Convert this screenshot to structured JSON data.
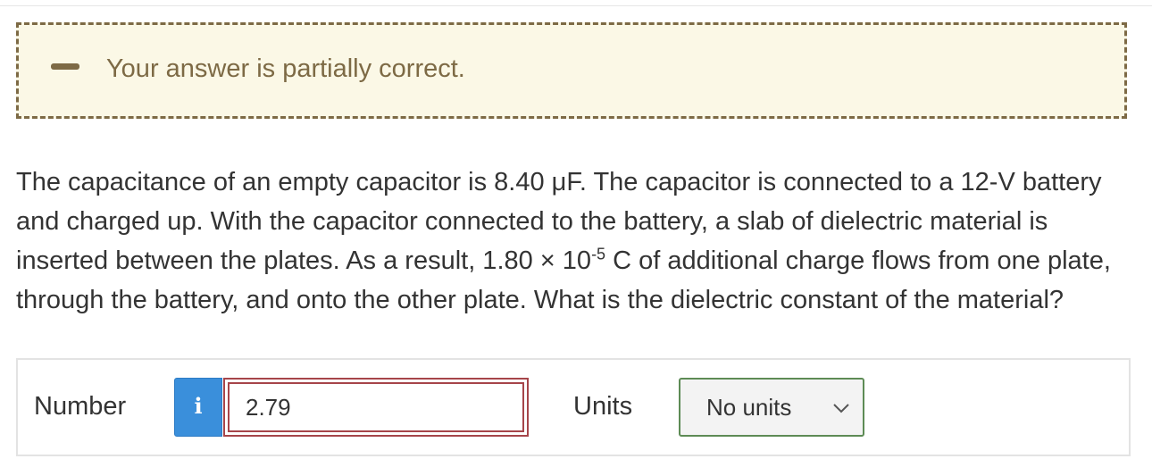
{
  "feedback": {
    "message": "Your answer is partially correct.",
    "icon": "minus-icon",
    "color": "#7d6a45",
    "background": "#fbf8e6"
  },
  "question": {
    "part1": "The capacitance of an empty capacitor is 8.40 μF. The capacitor is connected to a 12-V battery and charged up. With the capacitor connected to the battery, a slab of dielectric material is inserted between the plates. As a result, 1.80 × 10",
    "exponent": "-5",
    "part2": " C of additional charge flows from one plate, through the battery, and onto the other plate. What is the dielectric constant of the material?"
  },
  "answer": {
    "number_label": "Number",
    "info_label": "i",
    "number_value": "2.79",
    "units_label": "Units",
    "units_value": "No units",
    "input_border_color": "#a6454a",
    "select_border_color": "#5d8b55",
    "info_color": "#3a8fdb"
  }
}
